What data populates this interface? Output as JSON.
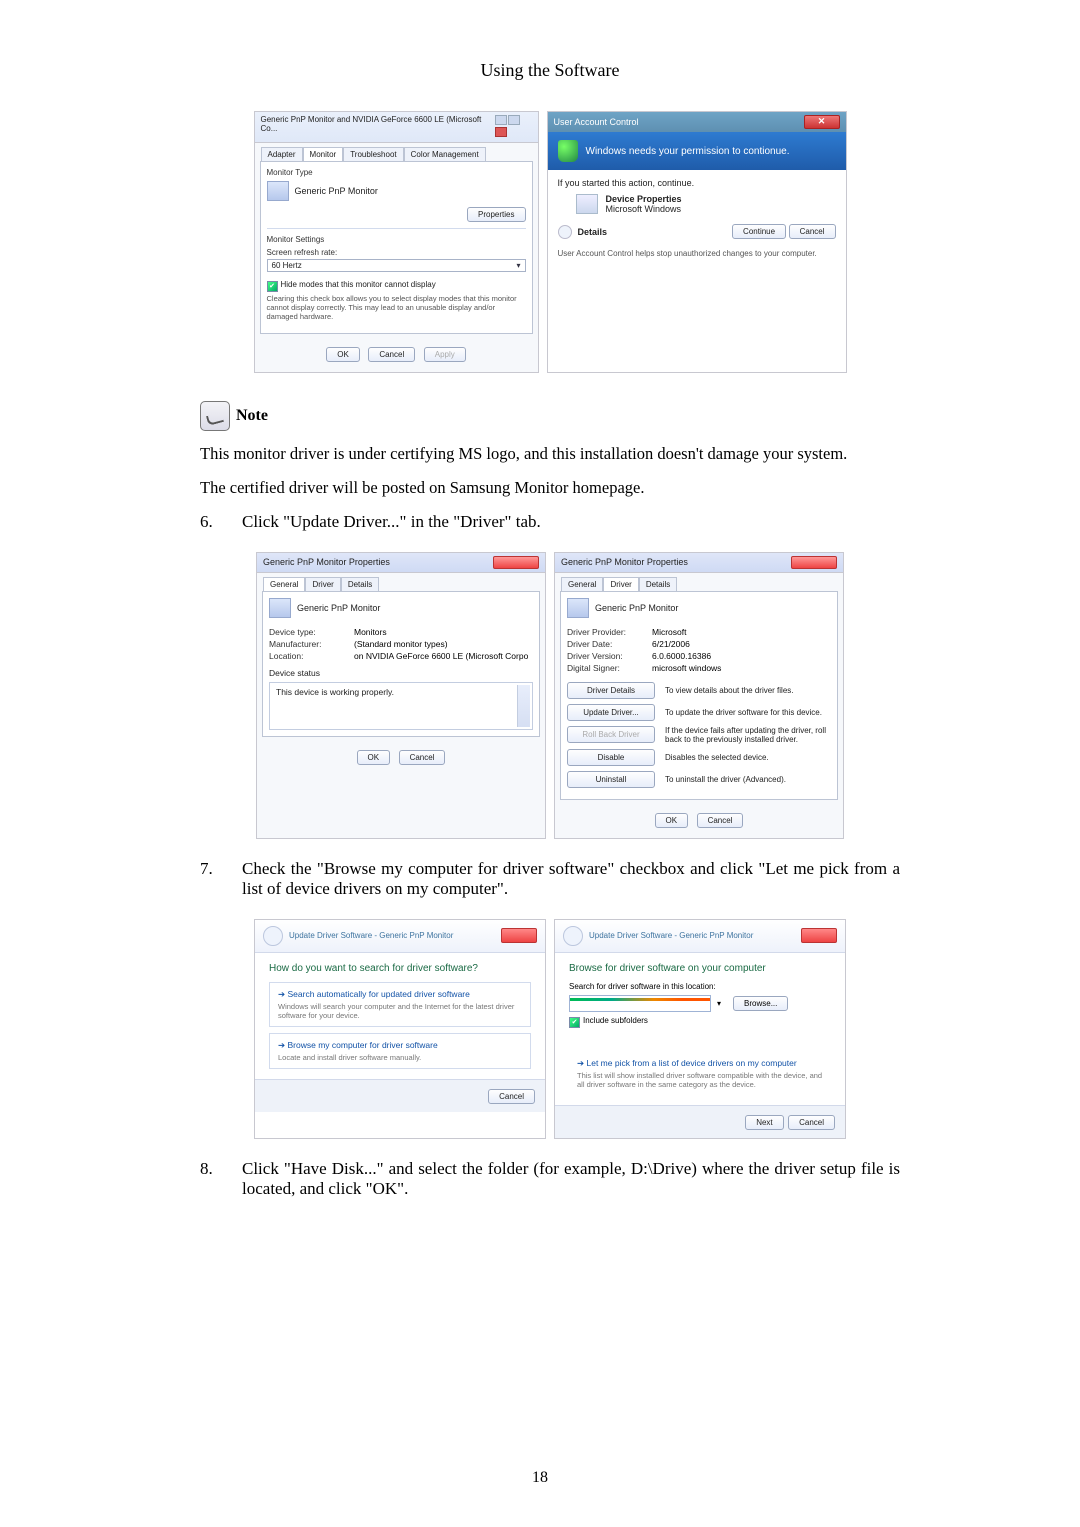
{
  "header": {
    "section_title": "Using the Software"
  },
  "page_number": "18",
  "dlg_monitor": {
    "title": "Generic PnP Monitor and NVIDIA GeForce 6600 LE (Microsoft Co...",
    "tabs": {
      "adapter": "Adapter",
      "monitor": "Monitor",
      "troubleshoot": "Troubleshoot",
      "color": "Color Management"
    },
    "monitor_type_label": "Monitor Type",
    "monitor_name": "Generic PnP Monitor",
    "properties_btn": "Properties",
    "monitor_settings_label": "Monitor Settings",
    "refresh_label": "Screen refresh rate:",
    "refresh_value": "60 Hertz",
    "hide_modes": "Hide modes that this monitor cannot display",
    "hide_modes_desc": "Clearing this check box allows you to select display modes that this monitor cannot display correctly. This may lead to an unusable display and/or damaged hardware.",
    "ok": "OK",
    "cancel": "Cancel",
    "apply": "Apply"
  },
  "uac": {
    "title": "User Account Control",
    "headline": "Windows needs your permission to contionue.",
    "started": "If you started this action, continue.",
    "device_prop": "Device Properties",
    "device_pub": "Microsoft Windows",
    "details": "Details",
    "continue": "Continue",
    "cancel": "Cancel",
    "helptext": "User Account Control helps stop unauthorized changes to your computer."
  },
  "note": {
    "label": "Note"
  },
  "paragraphs": {
    "cert_msg": "This monitor driver is under certifying MS logo, and this installation doesn't damage your system.",
    "posted_msg": "The certified driver will be posted on Samsung Monitor homepage."
  },
  "step6": {
    "num": "6.",
    "text": "Click \"Update Driver...\" in the \"Driver\" tab."
  },
  "props_general": {
    "title": "Generic PnP Monitor Properties",
    "tabs": {
      "general": "General",
      "driver": "Driver",
      "details": "Details"
    },
    "name": "Generic PnP Monitor",
    "device_type_k": "Device type:",
    "device_type_v": "Monitors",
    "manufacturer_k": "Manufacturer:",
    "manufacturer_v": "(Standard monitor types)",
    "location_k": "Location:",
    "location_v": "on NVIDIA GeForce 6600 LE (Microsoft Corpo",
    "status_label": "Device status",
    "status_text": "This device is working properly.",
    "ok": "OK",
    "cancel": "Cancel"
  },
  "props_driver": {
    "title": "Generic PnP Monitor Properties",
    "tabs": {
      "general": "General",
      "driver": "Driver",
      "details": "Details"
    },
    "name": "Generic PnP Monitor",
    "provider_k": "Driver Provider:",
    "provider_v": "Microsoft",
    "date_k": "Driver Date:",
    "date_v": "6/21/2006",
    "version_k": "Driver Version:",
    "version_v": "6.0.6000.16386",
    "signer_k": "Digital Signer:",
    "signer_v": "microsoft windows",
    "btn_details": "Driver Details",
    "desc_details": "To view details about the driver files.",
    "btn_update": "Update Driver...",
    "desc_update": "To update the driver software for this device.",
    "btn_rollback": "Roll Back Driver",
    "desc_rollback": "If the device fails after updating the driver, roll back to the previously installed driver.",
    "btn_disable": "Disable",
    "desc_disable": "Disables the selected device.",
    "btn_uninstall": "Uninstall",
    "desc_uninstall": "To uninstall the driver (Advanced).",
    "ok": "OK",
    "cancel": "Cancel"
  },
  "step7": {
    "num": "7.",
    "text": "Check the \"Browse my computer for driver software\" checkbox and click \"Let me pick from a list of device drivers on my computer\"."
  },
  "wizard1": {
    "breadcrumb": "Update Driver Software - Generic PnP Monitor",
    "question": "How do you want to search for driver software?",
    "opt1_h": "Search automatically for updated driver software",
    "opt1_d": "Windows will search your computer and the Internet for the latest driver software for your device.",
    "opt2_h": "Browse my computer for driver software",
    "opt2_d": "Locate and install driver software manually.",
    "cancel": "Cancel"
  },
  "wizard2": {
    "breadcrumb": "Update Driver Software - Generic PnP Monitor",
    "heading": "Browse for driver software on your computer",
    "search_label": "Search for driver software in this location:",
    "browse": "Browse...",
    "include_sub": "Include subfolders",
    "pick_h": "Let me pick from a list of device drivers on my computer",
    "pick_d": "This list will show installed driver software compatible with the device, and all driver software in the same category as the device.",
    "next": "Next",
    "cancel": "Cancel"
  },
  "step8": {
    "num": "8.",
    "text": "Click \"Have Disk...\" and select the folder (for example, D:\\Drive) where the driver setup file is located, and click \"OK\"."
  }
}
